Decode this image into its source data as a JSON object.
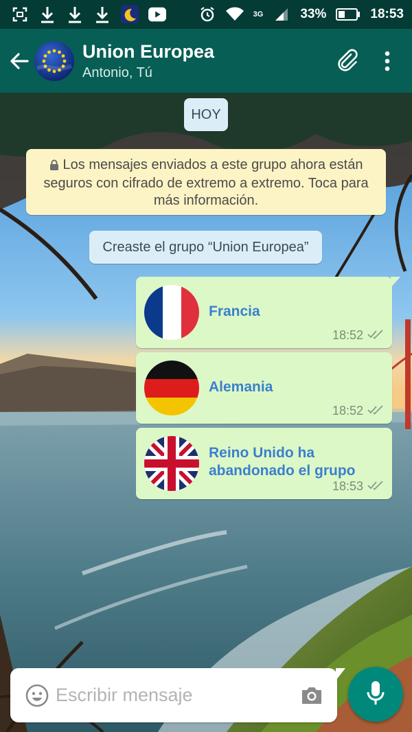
{
  "status_bar": {
    "battery_percent": "33%",
    "time": "18:53",
    "network_type": "3G",
    "icons": [
      "screenshot-icon",
      "download-icon",
      "download-icon",
      "download-icon",
      "moon-app-icon",
      "youtube-icon",
      "alarm-icon",
      "wifi-icon",
      "signal-icon",
      "battery-icon"
    ]
  },
  "header": {
    "title": "Union Europea",
    "subtitle": "Antonio, Tú",
    "icons": [
      "back-arrow-icon",
      "group-avatar",
      "attach-icon",
      "more-vert-icon"
    ]
  },
  "chat": {
    "day_chip": "HOY",
    "encryption_notice": "Los mensajes enviados a este grupo ahora están seguros con cifrado de extremo a extremo. Toca para más información.",
    "group_created": "Creaste el grupo “Union Europea”",
    "messages": [
      {
        "text": "Francia",
        "time": "18:52",
        "flag": "france"
      },
      {
        "text": "Alemania",
        "time": "18:52",
        "flag": "germany"
      },
      {
        "text": "Reino Unido ha abandonado el grupo",
        "time": "18:53",
        "flag": "united-kingdom"
      }
    ]
  },
  "composer": {
    "placeholder": "Escribir mensaje"
  },
  "colors": {
    "header": "#075e54",
    "status_bar": "#043b35",
    "outgoing_bubble": "#dcf8c6",
    "notice_bubble": "#fdf4c5",
    "system_chip": "#dbeef8",
    "mic_button": "#00897b",
    "message_text": "#3b7fcf"
  }
}
